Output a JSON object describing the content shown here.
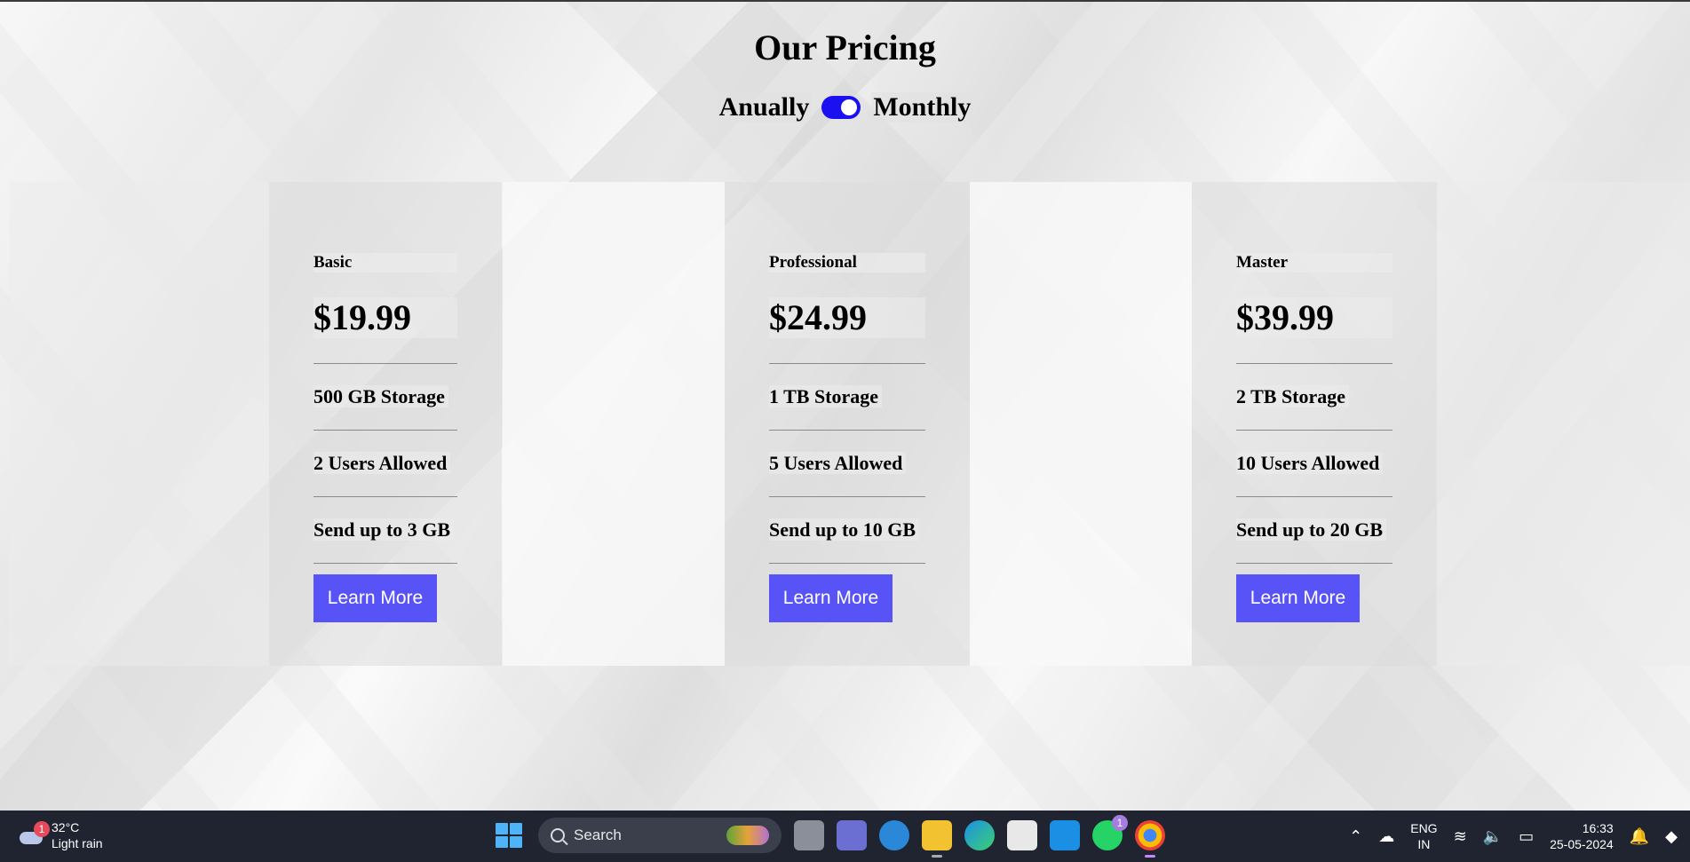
{
  "page": {
    "title": "Our Pricing",
    "toggle": {
      "left_label": "Anually",
      "right_label": "Monthly",
      "state": "on"
    }
  },
  "plans": [
    {
      "name": "Basic",
      "price": "$19.99",
      "features": [
        "500 GB Storage",
        "2 Users Allowed",
        "Send up to 3 GB"
      ],
      "button": "Learn More"
    },
    {
      "name": "Professional",
      "price": "$24.99",
      "features": [
        "1 TB Storage",
        "5 Users Allowed",
        "Send up to 10 GB"
      ],
      "button": "Learn More"
    },
    {
      "name": "Master",
      "price": "$39.99",
      "features": [
        "2 TB Storage",
        "10 Users Allowed",
        "Send up to 20 GB"
      ],
      "button": "Learn More"
    }
  ],
  "colors": {
    "button_bg": "#5853f6",
    "toggle_bg": "#1a10f0",
    "taskbar_bg": "#1f2430"
  },
  "taskbar": {
    "weather": {
      "temp": "32°C",
      "condition": "Light rain",
      "badge": "1",
      "icon": "weather-cloud-icon"
    },
    "search_placeholder": "Search",
    "whatsapp_badge": "1",
    "language": {
      "line1": "ENG",
      "line2": "IN"
    },
    "time": "16:33",
    "date": "25-05-2024"
  }
}
